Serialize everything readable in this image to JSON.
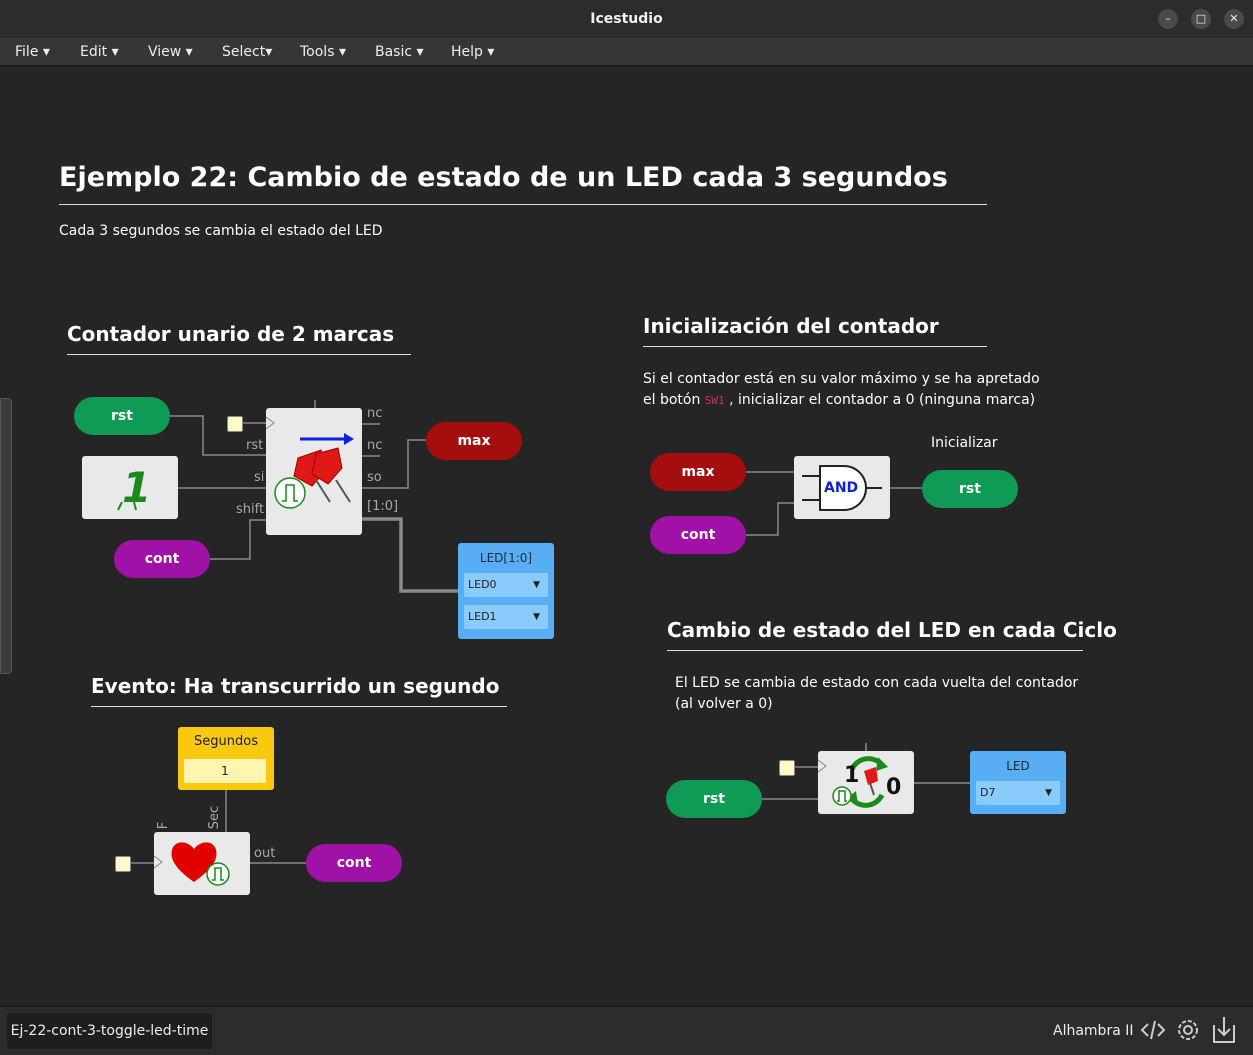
{
  "window": {
    "title": "Icestudio"
  },
  "menu": [
    "File",
    "Edit",
    "View",
    "Select",
    "Tools",
    "Basic",
    "Help"
  ],
  "header": {
    "title": "Ejemplo 22: Cambio de estado de un LED cada 3 segundos",
    "subtitle": "Cada 3 segundos se cambia el estado del LED"
  },
  "section_counter": {
    "title": "Contador unario de 2 marcas",
    "rst": "rst",
    "cont": "cont",
    "max": "max",
    "pins": {
      "rst": "rst",
      "si": "si",
      "shift": "shift",
      "nc1": "nc",
      "nc2": "nc",
      "so": "so",
      "bus": "[1:0]"
    },
    "led_title": "LED[1:0]",
    "led_options": [
      "LED0",
      "LED1"
    ]
  },
  "section_init": {
    "title": "Inicialización del contador",
    "line1": "Si el contador está en su valor máximo y se ha apretado",
    "line2_a": "el botón",
    "line2_code": "SW1",
    "line2_b": ", inicializar el contador a 0 (ninguna marca)",
    "label": "Inicializar",
    "max": "max",
    "cont": "cont",
    "gate": "AND",
    "rst": "rst"
  },
  "section_event": {
    "title": "Evento: Ha transcurrido un segundo",
    "param_title": "Segundos",
    "param_value": "1",
    "pins": {
      "F": "F",
      "Sec": "Sec",
      "out": "out"
    },
    "cont": "cont"
  },
  "section_toggle": {
    "title": "Cambio de estado del LED en cada Ciclo",
    "line1": "El LED se cambia de estado con cada vuelta del contador",
    "line2": "(al volver a 0)",
    "rst": "rst",
    "one": "1",
    "zero": "0",
    "led_title": "LED",
    "led_option": "D7"
  },
  "footer": {
    "file": "Ej-22-cont-3-toggle-led-time",
    "board": "Alhambra II"
  }
}
